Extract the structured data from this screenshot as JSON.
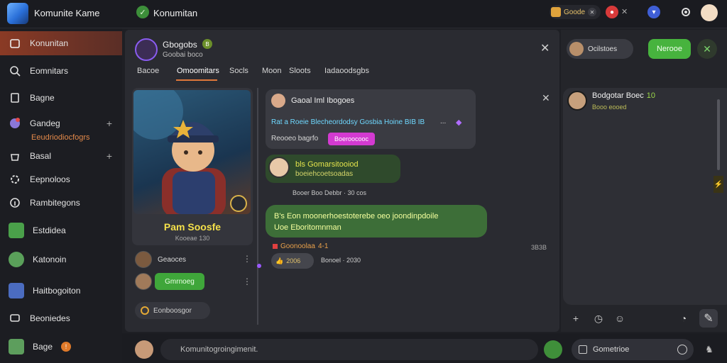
{
  "app": {
    "title": "Komunite Kame"
  },
  "topbar": {
    "channel_title": "Konumitan",
    "status_pill": "Goode",
    "alert_count": "",
    "colors": {
      "accent": "#d8613a",
      "green": "#47b33e",
      "purple": "#9b59ff"
    }
  },
  "sidebar": {
    "items": [
      {
        "label": "Konunitan",
        "icon": "home-icon"
      },
      {
        "label": "Eomnitars",
        "icon": "search-icon"
      },
      {
        "label": "Bagne",
        "icon": "file-icon"
      },
      {
        "label": "Gandeg",
        "icon": "gamepad-icon",
        "sub": "Eeudriodiocfogrs"
      },
      {
        "label": "Basal",
        "icon": "bag-icon"
      },
      {
        "label": "Eepnoloos",
        "icon": "cog-icon"
      },
      {
        "label": "Rambitegons",
        "icon": "info-icon"
      },
      {
        "label": "Estdidea"
      },
      {
        "label": "Katonoin"
      },
      {
        "label": "Haitbogoiton"
      },
      {
        "label": "Beoniedes",
        "icon": "chat-icon"
      },
      {
        "label": "Bage"
      }
    ]
  },
  "header": {
    "name": "Gbogobs",
    "verified": "B",
    "subtitle": "Goobai boco",
    "tabs": [
      "Bacoe",
      "Omoomitars",
      "Socls",
      "Moon",
      "Sloots",
      "Iadaoodsgbs"
    ]
  },
  "hero": {
    "name": "Pam Soosfe",
    "level": "Kooeae 130"
  },
  "members": [
    {
      "name": "Geaoces"
    },
    {
      "button": "Gmrnoeg"
    }
  ],
  "invite": {
    "label": "Eonboosgor"
  },
  "chat": {
    "msg1": {
      "title": "Gaoal Iml Ibogoes",
      "line": "Rat a Roeie  Blecheordodsy Gosbia Hoine  BIB  IB",
      "dots": "...",
      "label": "Reooeo bagrfo",
      "tag": "Boeroocooc"
    },
    "msg2": {
      "line1": "bls Gomarsitooiod",
      "line2": "boeiehcoetsoadas",
      "meta": "Booer Boo Debbr  · 30 cos"
    },
    "msg3": {
      "line1": "B's Eon moonerhoestoterebe oeo joondinpdoile",
      "line2": "Uoe Eboritomnman"
    },
    "reactions": {
      "label": "Goonoolaa",
      "count": "4-1",
      "time": "3B3B",
      "pill": "2006",
      "meta": "Bonoel · 2030"
    }
  },
  "right": {
    "search_label": "Ocilstoes",
    "join_label": "Nerooe",
    "card_name": "Bodgotar Boec",
    "card_badge": "10",
    "card_status": "Booo eooed"
  },
  "composer": {
    "placeholder": "Komunitogroingimenit.",
    "search": "Gometrioe"
  }
}
